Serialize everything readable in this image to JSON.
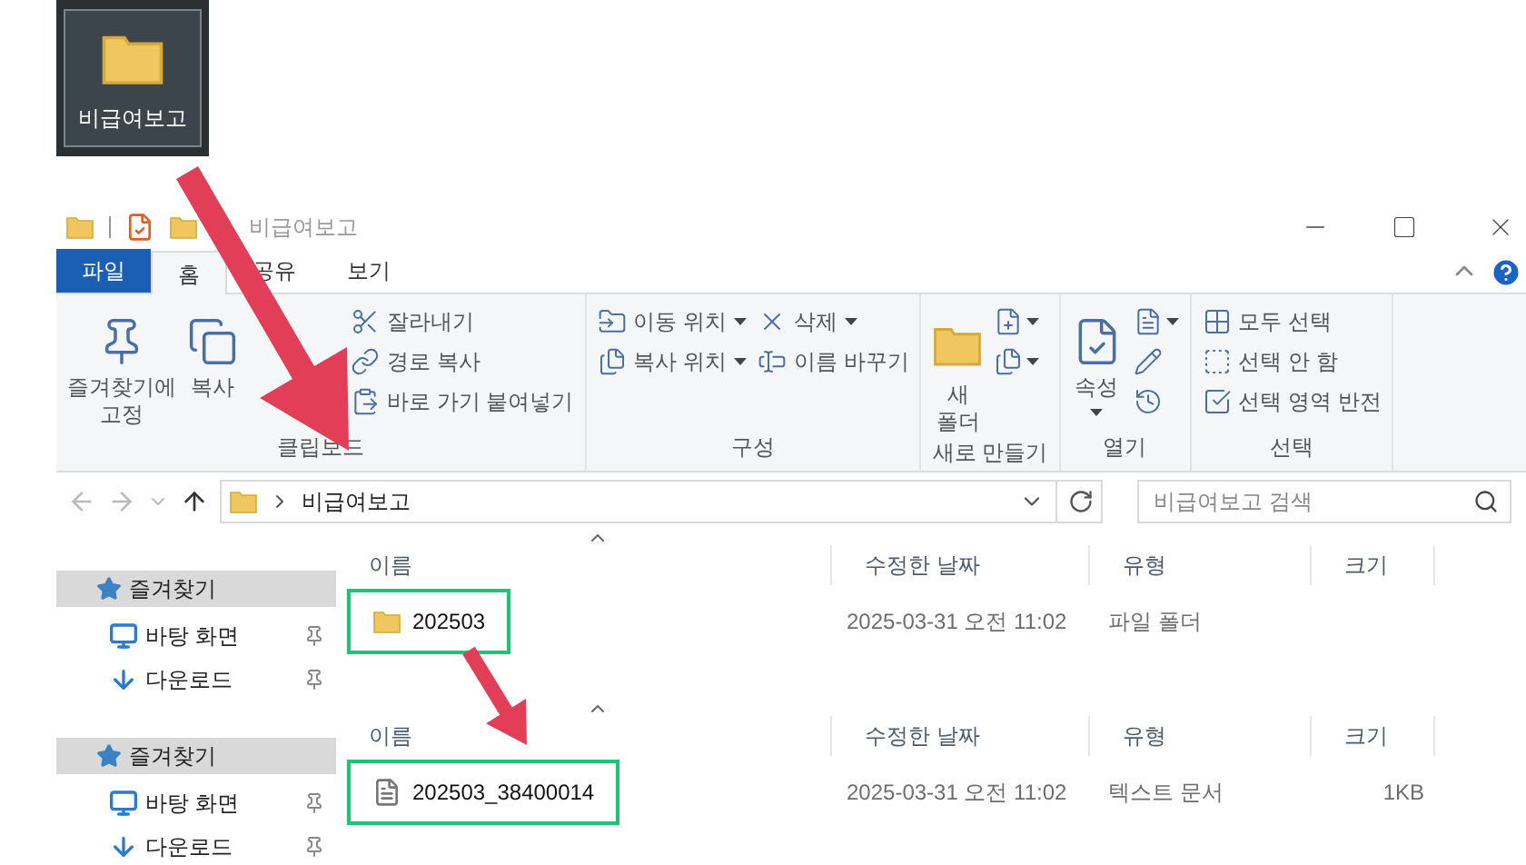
{
  "desktop_icon": {
    "label": "비급여보고"
  },
  "window": {
    "title": "비급여보고"
  },
  "tabs": [
    {
      "label": "파일",
      "kind": "file",
      "selected": false
    },
    {
      "label": "홈",
      "kind": "tab",
      "selected": true
    },
    {
      "label": "공유",
      "kind": "tab",
      "selected": false
    },
    {
      "label": "보기",
      "kind": "tab",
      "selected": false
    }
  ],
  "ribbon": {
    "groups": [
      {
        "label": "클립보드",
        "columns": [
          [
            {
              "kind": "large",
              "label": "즐겨찾기에\n고정"
            }
          ],
          [
            {
              "kind": "large",
              "label": "복사"
            }
          ],
          [
            {
              "kind": "hidden"
            }
          ],
          [
            {
              "kind": "small",
              "label": "잘라내기"
            },
            {
              "kind": "small",
              "label": "경로 복사"
            },
            {
              "kind": "small",
              "label": "바로 가기 붙여넣기"
            }
          ]
        ]
      },
      {
        "label": "구성",
        "columns": [
          [
            {
              "kind": "small",
              "label": "이동 위치",
              "dropdown": true
            },
            {
              "kind": "small",
              "label": "복사 위치",
              "dropdown": true
            }
          ],
          [
            {
              "kind": "small",
              "label": "삭제",
              "dropdown": true
            },
            {
              "kind": "small",
              "label": "이름 바꾸기"
            }
          ]
        ]
      },
      {
        "label": "새로 만들기",
        "columns": [
          [
            {
              "kind": "large",
              "label": "새\n폴더"
            }
          ],
          [
            {
              "kind": "icon",
              "dropdown": true
            },
            {
              "kind": "icon",
              "dropdown": true
            }
          ]
        ]
      },
      {
        "label": "열기",
        "columns": [
          [
            {
              "kind": "large",
              "label": "속성",
              "dropdown": true
            }
          ],
          [
            {
              "kind": "icon",
              "dropdown": true
            },
            {
              "kind": "icon"
            },
            {
              "kind": "icon"
            }
          ]
        ]
      },
      {
        "label": "선택",
        "columns": [
          [
            {
              "kind": "small",
              "label": "모두 선택"
            },
            {
              "kind": "small",
              "label": "선택 안 함"
            },
            {
              "kind": "small",
              "label": "선택 영역 반전"
            }
          ]
        ]
      }
    ]
  },
  "address": {
    "path": "비급여보고"
  },
  "search": {
    "placeholder": "비급여보고 검색"
  },
  "panes": [
    {
      "sidebar": [
        {
          "kind": "header",
          "label": "즐겨찾기",
          "selected": true
        },
        {
          "kind": "desktop",
          "label": "바탕 화면",
          "selected": false
        },
        {
          "kind": "download",
          "label": "다운로드",
          "selected": false
        }
      ],
      "columns": [
        "이름",
        "수정한 날짜",
        "유형",
        "크기"
      ],
      "rows": [
        {
          "kind": "folder",
          "name": "202503",
          "modified": "2025-03-31 오전 11:02",
          "type": "파일 폴더",
          "highlighted": true
        }
      ]
    },
    {
      "sidebar": [
        {
          "kind": "header",
          "label": "즐겨찾기",
          "selected": true
        },
        {
          "kind": "desktop",
          "label": "바탕 화면",
          "selected": false
        },
        {
          "kind": "download",
          "label": "다운로드",
          "selected": false
        }
      ],
      "columns": [
        "이름",
        "수정한 날짜",
        "유형",
        "크기"
      ],
      "rows": [
        {
          "kind": "text",
          "name": "202503_38400014",
          "modified": "2025-03-31 오전 11:02",
          "type": "텍스트 문서",
          "size": "1KB",
          "highlighted": true
        }
      ]
    }
  ]
}
